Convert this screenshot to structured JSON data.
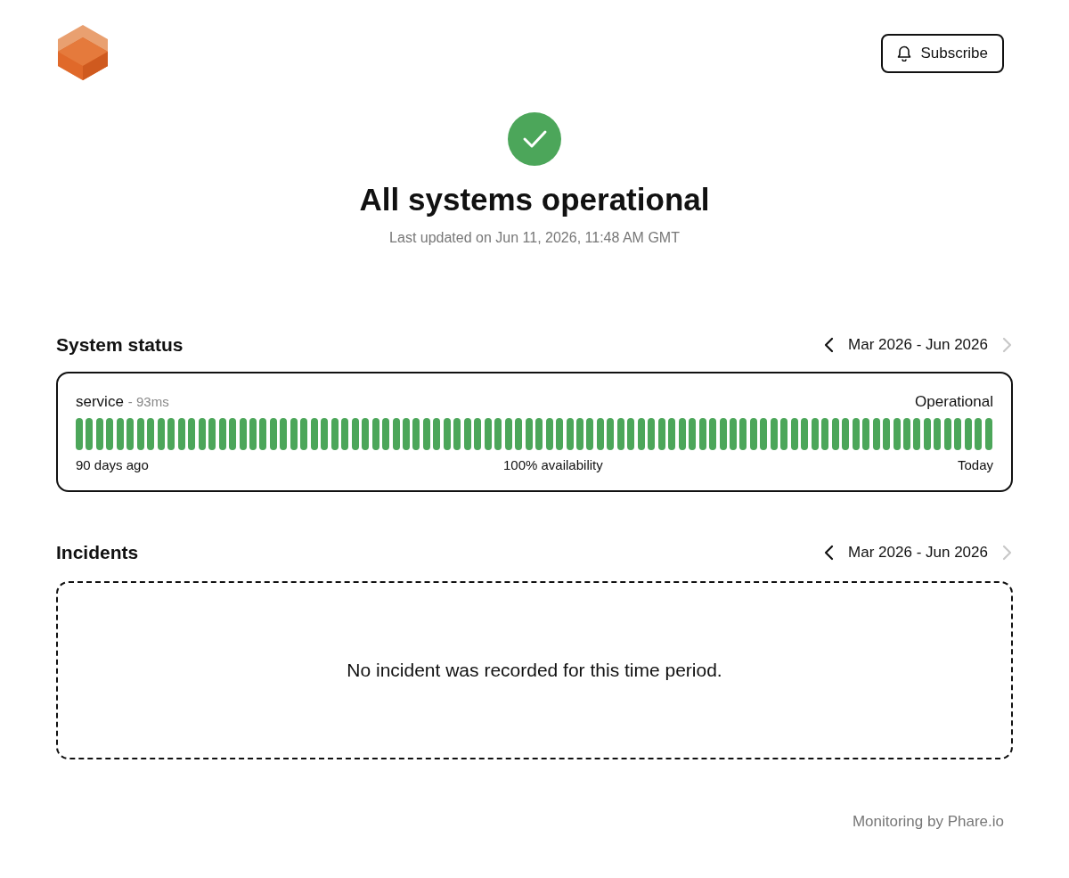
{
  "header": {
    "subscribe_button": "Subscribe"
  },
  "hero": {
    "all_operational": true,
    "title": "All systems operational",
    "updated": "Last updated on Jun 11, 2026, 11:48 AM GMT"
  },
  "system_status": {
    "title": "System status",
    "range": "Mar 2026 - Jun 2026",
    "prev_disabled": false,
    "next_disabled": true,
    "services": [
      {
        "name": "service",
        "latency": "- 93ms",
        "status": "Operational",
        "start_label": "90 days ago",
        "availability": "100% availability",
        "end_label": "Today",
        "days": [
          {
            "color": "#4ca65a"
          },
          {
            "color": "#4ca65a"
          },
          {
            "color": "#4ca65a"
          },
          {
            "color": "#4ca65a"
          },
          {
            "color": "#4ca65a"
          },
          {
            "color": "#4ca65a"
          },
          {
            "color": "#4ca65a"
          },
          {
            "color": "#4ca65a"
          },
          {
            "color": "#4ca65a"
          },
          {
            "color": "#4ca65a"
          },
          {
            "color": "#4ca65a"
          },
          {
            "color": "#4ca65a"
          },
          {
            "color": "#4ca65a"
          },
          {
            "color": "#4ca65a"
          },
          {
            "color": "#4ca65a"
          },
          {
            "color": "#4ca65a"
          },
          {
            "color": "#4ca65a"
          },
          {
            "color": "#4ca65a"
          },
          {
            "color": "#4ca65a"
          },
          {
            "color": "#4ca65a"
          },
          {
            "color": "#4ca65a"
          },
          {
            "color": "#4ca65a"
          },
          {
            "color": "#4ca65a"
          },
          {
            "color": "#4ca65a"
          },
          {
            "color": "#4ca65a"
          },
          {
            "color": "#4ca65a"
          },
          {
            "color": "#4ca65a"
          },
          {
            "color": "#4ca65a"
          },
          {
            "color": "#4ca65a"
          },
          {
            "color": "#4ca65a"
          },
          {
            "color": "#4ca65a"
          },
          {
            "color": "#4ca65a"
          },
          {
            "color": "#4ca65a"
          },
          {
            "color": "#4ca65a"
          },
          {
            "color": "#4ca65a"
          },
          {
            "color": "#4ca65a"
          },
          {
            "color": "#4ca65a"
          },
          {
            "color": "#4ca65a"
          },
          {
            "color": "#4ca65a"
          },
          {
            "color": "#4ca65a"
          },
          {
            "color": "#4ca65a"
          },
          {
            "color": "#4ca65a"
          },
          {
            "color": "#4ca65a"
          },
          {
            "color": "#4ca65a"
          },
          {
            "color": "#4ca65a"
          },
          {
            "color": "#4ca65a"
          },
          {
            "color": "#4ca65a"
          },
          {
            "color": "#4ca65a"
          },
          {
            "color": "#4ca65a"
          },
          {
            "color": "#4ca65a"
          },
          {
            "color": "#4ca65a"
          },
          {
            "color": "#4ca65a"
          },
          {
            "color": "#4ca65a"
          },
          {
            "color": "#4ca65a"
          },
          {
            "color": "#4ca65a"
          },
          {
            "color": "#4ca65a"
          },
          {
            "color": "#4ca65a"
          },
          {
            "color": "#4ca65a"
          },
          {
            "color": "#4ca65a"
          },
          {
            "color": "#4ca65a"
          },
          {
            "color": "#4ca65a"
          },
          {
            "color": "#4ca65a"
          },
          {
            "color": "#4ca65a"
          },
          {
            "color": "#4ca65a"
          },
          {
            "color": "#4ca65a"
          },
          {
            "color": "#4ca65a"
          },
          {
            "color": "#4ca65a"
          },
          {
            "color": "#4ca65a"
          },
          {
            "color": "#4ca65a"
          },
          {
            "color": "#4ca65a"
          },
          {
            "color": "#4ca65a"
          },
          {
            "color": "#4ca65a"
          },
          {
            "color": "#4ca65a"
          },
          {
            "color": "#4ca65a"
          },
          {
            "color": "#4ca65a"
          },
          {
            "color": "#4ca65a"
          },
          {
            "color": "#4ca65a"
          },
          {
            "color": "#4ca65a"
          },
          {
            "color": "#4ca65a"
          },
          {
            "color": "#4ca65a"
          },
          {
            "color": "#4ca65a"
          },
          {
            "color": "#4ca65a"
          },
          {
            "color": "#4ca65a"
          },
          {
            "color": "#4ca65a"
          },
          {
            "color": "#4ca65a"
          },
          {
            "color": "#4ca65a"
          },
          {
            "color": "#4ca65a"
          },
          {
            "color": "#4ca65a"
          },
          {
            "color": "#4ca65a"
          },
          {
            "color": "#4ca65a"
          }
        ]
      }
    ]
  },
  "incidents": {
    "title": "Incidents",
    "range": "Mar 2026 - Jun 2026",
    "prev_disabled": false,
    "next_disabled": true,
    "empty_message": "No incident was recorded for this time period."
  },
  "footer": {
    "credit": "Monitoring by Phare.io"
  }
}
